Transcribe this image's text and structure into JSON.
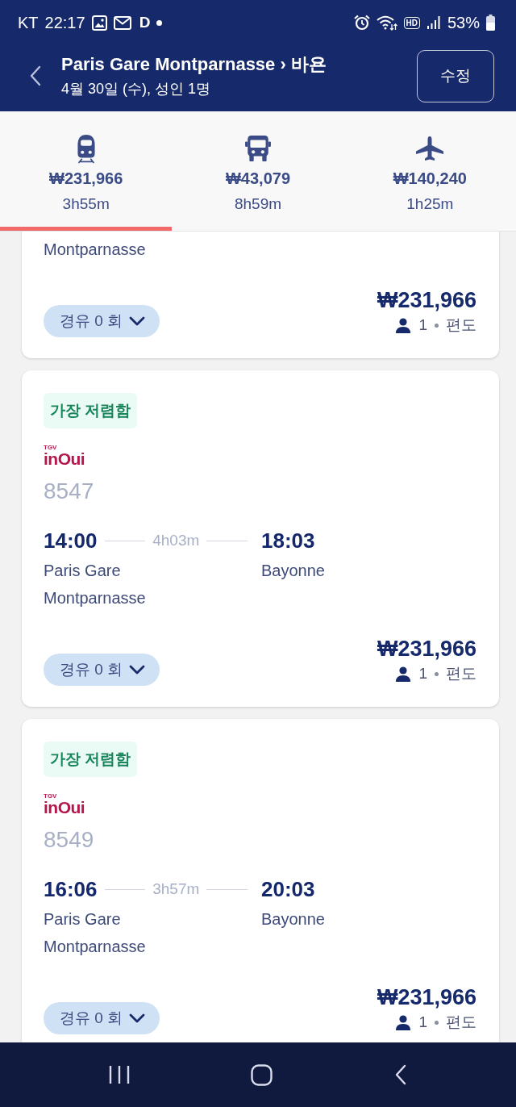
{
  "status_bar": {
    "carrier": "KT",
    "time": "22:17",
    "app_letter": "D",
    "hd_label": "HD",
    "battery": "53%"
  },
  "header": {
    "title": "Paris Gare Montparnasse › 바욘",
    "subtitle": "4월 30일 (수), 성인 1명",
    "edit_button": "수정"
  },
  "mode_tabs": [
    {
      "kind": "train",
      "price": "₩231,966",
      "duration": "3h55m",
      "selected": true
    },
    {
      "kind": "bus",
      "price": "₩43,079",
      "duration": "8h59m",
      "selected": false
    },
    {
      "kind": "plane",
      "price": "₩140,240",
      "duration": "1h25m",
      "selected": false
    }
  ],
  "results": [
    {
      "departure_station": "Montparnasse",
      "stops": "경유 0 회",
      "price": "₩231,966",
      "passengers": "1",
      "trip_type": "편도"
    },
    {
      "badge": "가장 저렴함",
      "operator": {
        "tag": "TGV",
        "name": "inOui"
      },
      "train_number": "8547",
      "departure_time": "14:00",
      "duration": "4h03m",
      "arrival_time": "18:03",
      "departure_station": "Paris Gare Montparnasse",
      "arrival_station": "Bayonne",
      "stops": "경유 0 회",
      "price": "₩231,966",
      "passengers": "1",
      "trip_type": "편도"
    },
    {
      "badge": "가장 저렴함",
      "operator": {
        "tag": "TGV",
        "name": "inOui"
      },
      "train_number": "8549",
      "departure_time": "16:06",
      "duration": "3h57m",
      "arrival_time": "20:03",
      "departure_station": "Paris Gare Montparnasse",
      "arrival_station": "Bayonne",
      "stops": "경유 0 회",
      "price": "₩231,966",
      "passengers": "1",
      "trip_type": "편도"
    }
  ]
}
